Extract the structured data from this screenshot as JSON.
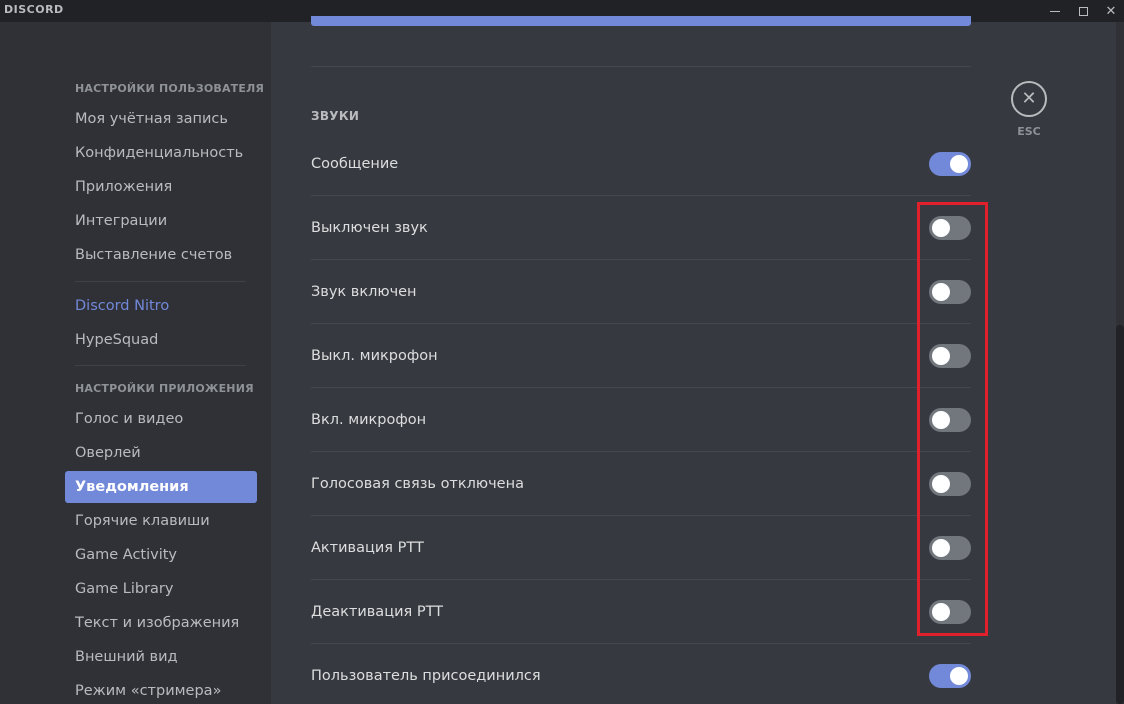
{
  "app": {
    "brand": "DISCORD",
    "window_controls": {
      "minimize": "minimize",
      "maximize": "maximize",
      "close": "✕"
    }
  },
  "sidebar": {
    "user_settings_header": "НАСТРОЙКИ ПОЛЬЗОВАТЕЛЯ",
    "user_items": [
      "Моя учётная запись",
      "Конфиденциальность",
      "Приложения",
      "Интеграции",
      "Выставление счетов"
    ],
    "nitro_items": [
      "Discord Nitro",
      "HypeSquad"
    ],
    "app_settings_header": "НАСТРОЙКИ ПРИЛОЖЕНИЯ",
    "app_items": [
      "Голос и видео",
      "Оверлей",
      "Уведомления",
      "Горячие клавиши",
      "Game Activity",
      "Game Library",
      "Текст и изображения",
      "Внешний вид",
      "Режим «стримера»"
    ],
    "active_item": "Уведомления"
  },
  "main": {
    "section_title": "ЗВУКИ",
    "sounds": [
      {
        "label": "Сообщение",
        "enabled": true
      },
      {
        "label": "Выключен звук",
        "enabled": false
      },
      {
        "label": "Звук включен",
        "enabled": false
      },
      {
        "label": "Выкл. микрофон",
        "enabled": false
      },
      {
        "label": "Вкл. микрофон",
        "enabled": false
      },
      {
        "label": "Голосовая связь отключена",
        "enabled": false
      },
      {
        "label": "Активация PTT",
        "enabled": false
      },
      {
        "label": "Деактивация PTT",
        "enabled": false
      },
      {
        "label": "Пользователь присоединился",
        "enabled": true
      }
    ]
  },
  "close": {
    "icon": "✕",
    "label": "ESC"
  },
  "colors": {
    "accent": "#7289da",
    "toggle_off": "#72767d",
    "highlight": "#e0202a"
  }
}
